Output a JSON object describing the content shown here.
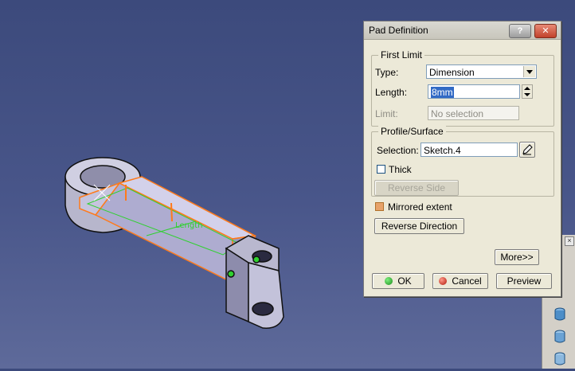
{
  "dialog": {
    "title": "Pad Definition",
    "help_glyph": "?",
    "close_glyph": "✕",
    "first_limit": {
      "group_title": "First Limit",
      "type_label": "Type:",
      "type_value": "Dimension",
      "length_label": "Length:",
      "length_value": "8mm",
      "limit_label": "Limit:",
      "limit_value": "No selection"
    },
    "profile": {
      "group_title": "Profile/Surface",
      "selection_label": "Selection:",
      "selection_value": "Sketch.4",
      "thick_label": "Thick",
      "thick_checked": false,
      "reverse_side_label": "Reverse Side"
    },
    "mirrored_extent_label": "Mirrored extent",
    "mirrored_extent_checked": true,
    "reverse_direction_label": "Reverse Direction",
    "more_label": "More>>",
    "ok_label": "OK",
    "cancel_label": "Cancel",
    "preview_label": "Preview"
  },
  "viewport": {
    "dimension_label": "Length"
  },
  "toolbar": {
    "close_glyph": "×",
    "icons": [
      "cylinder-icon",
      "cylinder-icon",
      "cylinder-icon",
      "cylinder-icon"
    ]
  },
  "colors": {
    "background_top": "#3c4a7c",
    "highlight_orange": "#ff7a1a",
    "sketch_green": "#2fd12f",
    "part_fill": "#c9c8dc",
    "dialog_bg": "#ece9d8"
  }
}
